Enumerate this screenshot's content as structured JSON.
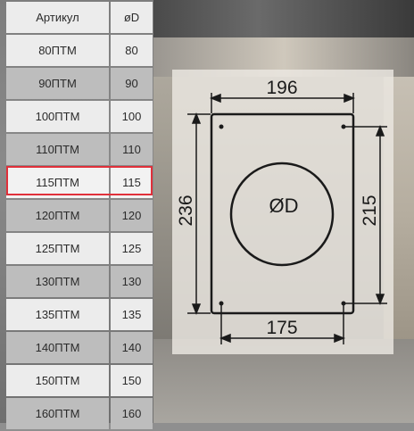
{
  "table": {
    "header": {
      "article": "Артикул",
      "diameter": "øD"
    },
    "rows": [
      {
        "article": "80ПТМ",
        "d": "80"
      },
      {
        "article": "90ПТМ",
        "d": "90"
      },
      {
        "article": "100ПТМ",
        "d": "100"
      },
      {
        "article": "110ПТМ",
        "d": "110"
      },
      {
        "article": "115ПТМ",
        "d": "115"
      },
      {
        "article": "120ПТМ",
        "d": "120"
      },
      {
        "article": "125ПТМ",
        "d": "125"
      },
      {
        "article": "130ПТМ",
        "d": "130"
      },
      {
        "article": "135ПТМ",
        "d": "135"
      },
      {
        "article": "140ПТМ",
        "d": "140"
      },
      {
        "article": "150ПТМ",
        "d": "150"
      },
      {
        "article": "160ПТМ",
        "d": "160"
      }
    ],
    "selected_row": "115ПТМ",
    "highlight_color": "#e0303a"
  },
  "drawing": {
    "top_width": "196",
    "bottom_hole_spacing": "175",
    "height": "236",
    "hole_vertical_spacing": "215",
    "circle_label": "ØD"
  }
}
